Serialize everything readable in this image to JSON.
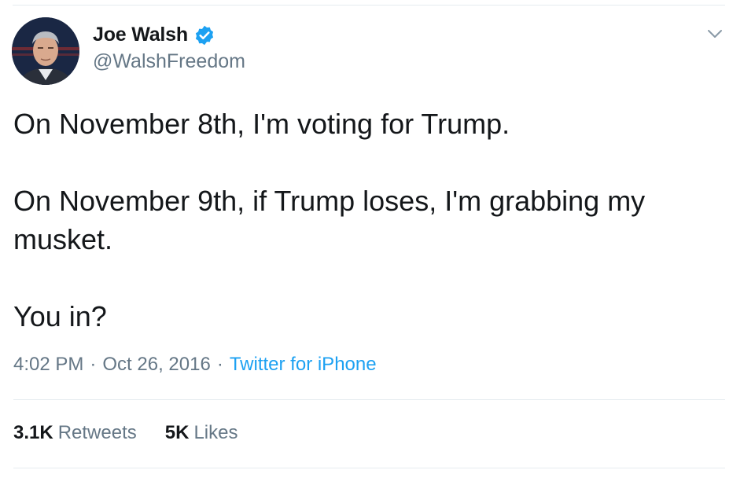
{
  "author": {
    "display_name": "Joe Walsh",
    "handle": "@WalshFreedom",
    "verified": true,
    "verified_color": "#1da1f2"
  },
  "tweet": {
    "lines": [
      "On November 8th, I'm voting for Trump.",
      "On November 9th, if Trump loses, I'm grabbing my musket.",
      "You in?"
    ],
    "time": "4:02 PM",
    "separator": "·",
    "date": "Oct 26, 2016",
    "source": "Twitter for iPhone"
  },
  "stats": {
    "retweets_count": "3.1K",
    "retweets_label": "Retweets",
    "likes_count": "5K",
    "likes_label": "Likes"
  },
  "icons": {
    "verified": "verified-badge-icon",
    "menu": "chevron-down-icon"
  },
  "colors": {
    "text": "#14171a",
    "secondary": "#657786",
    "link": "#1da1f2",
    "divider": "#e6ecf0"
  }
}
